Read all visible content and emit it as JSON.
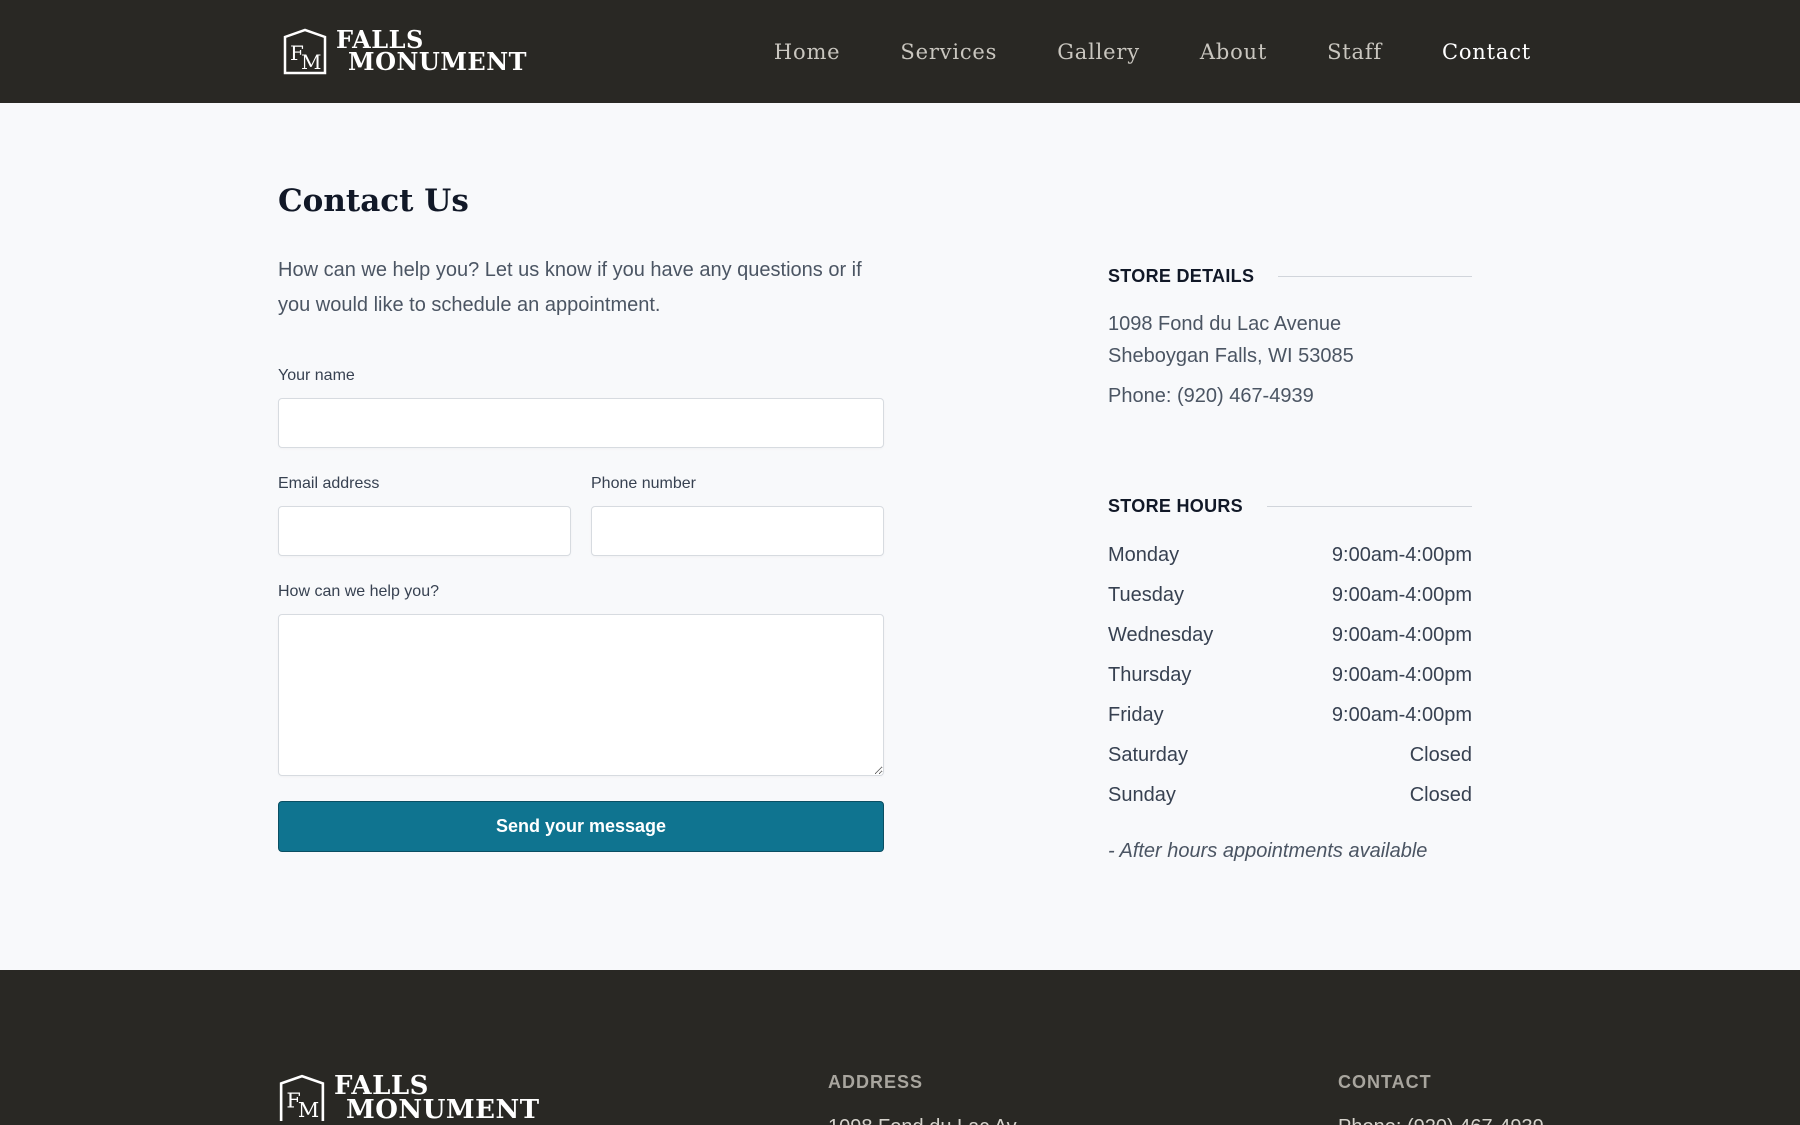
{
  "header": {
    "logo": {
      "line1": "FALLS",
      "line2": "MONUMENT",
      "monogram": "FM"
    },
    "nav": [
      {
        "label": "Home"
      },
      {
        "label": "Services"
      },
      {
        "label": "Gallery"
      },
      {
        "label": "About"
      },
      {
        "label": "Staff"
      },
      {
        "label": "Contact",
        "active": true
      }
    ]
  },
  "main": {
    "title": "Contact Us",
    "intro": "How can we help you? Let us know if you have any questions or if you would like to schedule an appointment.",
    "form": {
      "name_label": "Your name",
      "name_value": "",
      "email_label": "Email address",
      "email_value": "",
      "phone_label": "Phone number",
      "phone_value": "",
      "message_label": "How can we help you?",
      "message_value": "",
      "submit_label": "Send your message"
    },
    "store_details": {
      "heading": "STORE DETAILS",
      "address_line1": "1098 Fond du Lac Avenue",
      "address_line2": "Sheboygan Falls, WI 53085",
      "phone": "Phone: (920) 467-4939"
    },
    "store_hours": {
      "heading": "STORE HOURS",
      "rows": [
        {
          "day": "Monday",
          "hours": "9:00am-4:00pm"
        },
        {
          "day": "Tuesday",
          "hours": "9:00am-4:00pm"
        },
        {
          "day": "Wednesday",
          "hours": "9:00am-4:00pm"
        },
        {
          "day": "Thursday",
          "hours": "9:00am-4:00pm"
        },
        {
          "day": "Friday",
          "hours": "9:00am-4:00pm"
        },
        {
          "day": "Saturday",
          "hours": "Closed"
        },
        {
          "day": "Sunday",
          "hours": "Closed"
        }
      ],
      "note": "- After hours appointments available"
    }
  },
  "footer": {
    "logo": {
      "line1": "FALLS",
      "line2": "MONUMENT",
      "monogram": "FM"
    },
    "address_heading": "ADDRESS",
    "address_partial": "1098 Fond du Lac Av",
    "contact_heading": "CONTACT",
    "contact_partial": "Phone: (920) 467-4939"
  },
  "colors": {
    "header_bg": "#292824",
    "page_bg": "#f8f9fb",
    "accent_button": "#0f7490"
  }
}
